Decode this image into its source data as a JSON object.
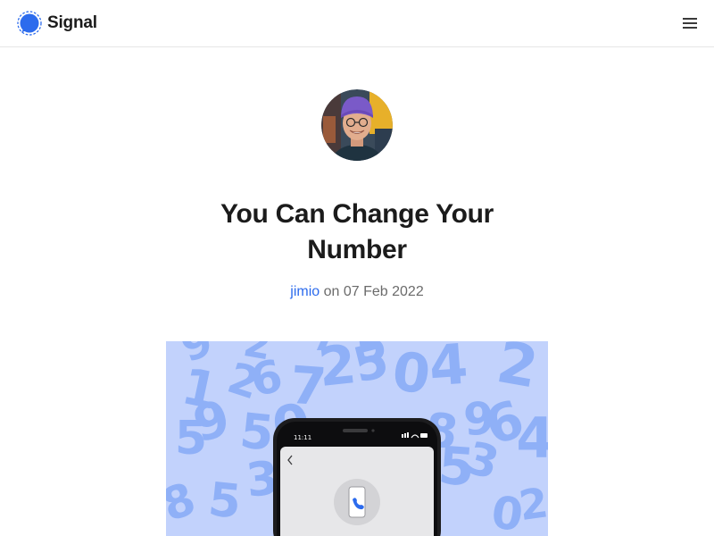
{
  "header": {
    "brand_name": "Signal",
    "logo_icon": "signal-bubble-icon",
    "menu_icon": "hamburger-menu-icon"
  },
  "post": {
    "author_avatar": "author-avatar-photo",
    "title": "You Can Change Your Number",
    "author": "jimio",
    "date_prefix": "on",
    "date": "07 Feb 2022"
  },
  "hero": {
    "phone_time": "11:11",
    "back_icon": "chevron-left-icon",
    "phone_icon": "phone-handset-icon",
    "numbers": [
      "9",
      "2",
      "7",
      "5",
      "1",
      "2",
      "6",
      "7",
      "2",
      "5",
      "0",
      "4",
      "2",
      "5",
      "9",
      "5",
      "0",
      "9",
      "8",
      "6",
      "5",
      "3",
      "4",
      "0",
      "2",
      "8",
      "5",
      "3"
    ]
  },
  "colors": {
    "accent": "#2c6bed",
    "hero_background": "#c2d2fc",
    "hero_digits": "#8fb0f7",
    "title_text": "#1b1b1b",
    "meta_text": "#6b6b6b"
  }
}
